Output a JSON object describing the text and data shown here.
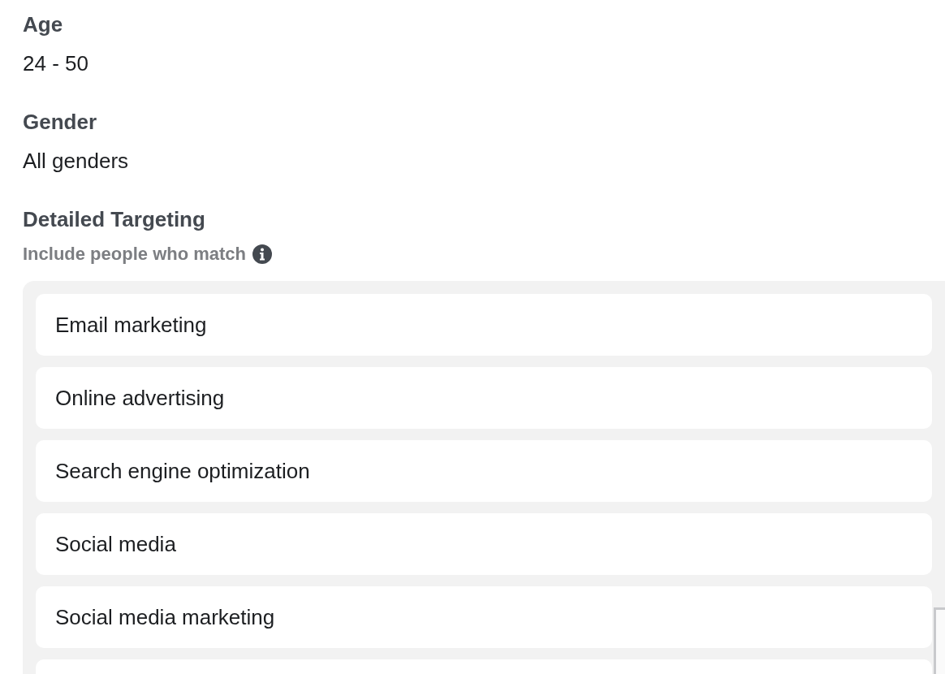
{
  "fields": [
    {
      "label": "Age",
      "value": "24 - 50"
    },
    {
      "label": "Gender",
      "value": "All genders"
    }
  ],
  "detailed_targeting": {
    "label": "Detailed Targeting",
    "sublabel": "Include people who match",
    "items": [
      {
        "kind": "entry",
        "text": "Email marketing"
      },
      {
        "kind": "entry",
        "text": "Online advertising"
      },
      {
        "kind": "entry",
        "text": "Search engine optimization"
      },
      {
        "kind": "entry",
        "text": "Social media"
      },
      {
        "kind": "entry",
        "text": "Social media marketing"
      },
      {
        "kind": "cut_off"
      }
    ]
  }
}
